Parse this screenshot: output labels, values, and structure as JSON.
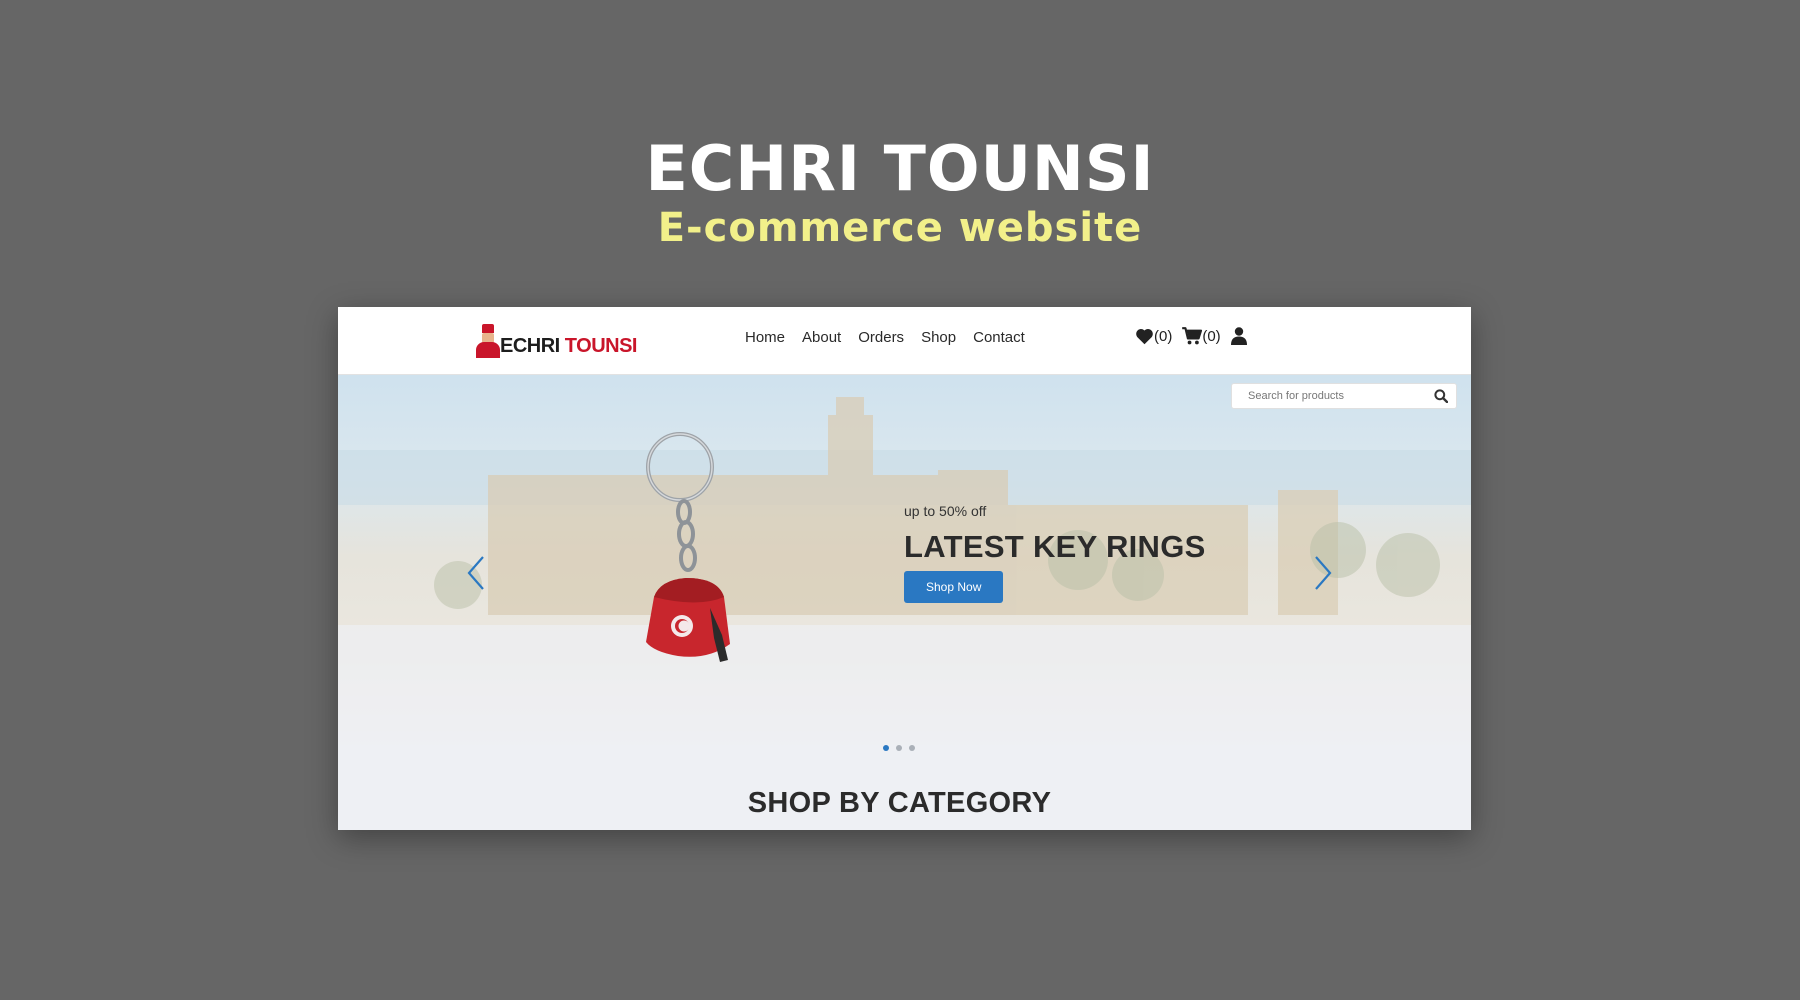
{
  "presentation": {
    "title": "ECHRI TOUNSI",
    "subtitle": "E-commerce website"
  },
  "site": {
    "logo": {
      "text_dark": "ECHRI",
      "text_red": "TOUNSI"
    },
    "nav": {
      "items": [
        {
          "label": "Home"
        },
        {
          "label": "About"
        },
        {
          "label": "Orders"
        },
        {
          "label": "Shop"
        },
        {
          "label": "Contact"
        }
      ]
    },
    "actions": {
      "wishlist_count": "(0)",
      "cart_count": "(0)",
      "icons": [
        "heart-icon",
        "cart-icon",
        "user-icon"
      ]
    },
    "search": {
      "placeholder": "Search for products"
    },
    "hero": {
      "discount": "up to 50% off",
      "heading": "LATEST KEY RINGS",
      "button_label": "Shop Now",
      "slides": 3,
      "active_slide": 1
    },
    "sections": {
      "category_title": "SHOP BY CATEGORY"
    }
  },
  "colors": {
    "background": "#666666",
    "accent_blue": "#2a78c2",
    "brand_red": "#c9152a",
    "subtitle_yellow": "#f2f08a"
  }
}
